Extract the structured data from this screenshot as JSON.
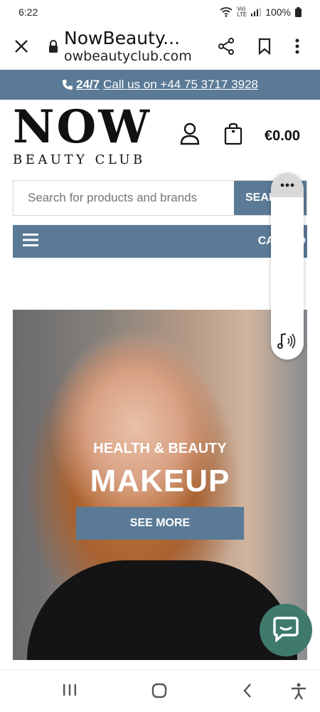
{
  "status": {
    "time": "6:22",
    "battery": "100%",
    "network": "Vo) LTE"
  },
  "browser": {
    "title": "NowBeauty...",
    "url": "owbeautyclub.com"
  },
  "callbar": {
    "hours": "24/7",
    "text": "Call us on +44 75 3717 3928"
  },
  "logo": {
    "main": "NOW",
    "sub": "BEAUTY CLUB"
  },
  "header": {
    "cart_total": "€0.00"
  },
  "search": {
    "placeholder": "Search for products and brands",
    "button": "SEAR"
  },
  "category": {
    "label": "CATEGO"
  },
  "hero": {
    "kicker": "HEALTH & BEAUTY",
    "title": "MAKEUP",
    "button": "SEE MORE"
  },
  "colors": {
    "accent": "#5a7a96",
    "chat": "#3f7a6c"
  },
  "icons": [
    "close-icon",
    "lock-icon",
    "share-icon",
    "bookmark-icon",
    "more-vert-icon",
    "phone-icon",
    "user-icon",
    "shopping-bag-icon",
    "hamburger-icon",
    "chat-icon",
    "more-horiz-icon",
    "audio-icon",
    "recents-icon",
    "home-icon",
    "back-icon",
    "accessibility-icon"
  ]
}
